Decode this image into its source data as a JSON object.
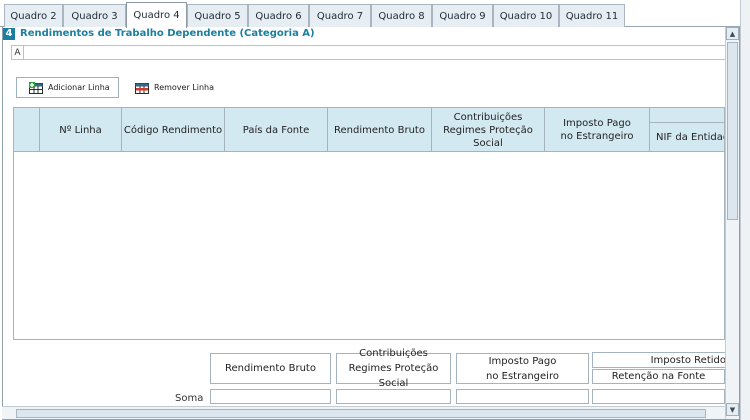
{
  "tabs": [
    {
      "label": "Quadro 2",
      "active": false
    },
    {
      "label": "Quadro 3",
      "active": false
    },
    {
      "label": "Quadro 4",
      "active": true
    },
    {
      "label": "Quadro 5",
      "active": false
    },
    {
      "label": "Quadro 6",
      "active": false
    },
    {
      "label": "Quadro 7",
      "active": false
    },
    {
      "label": "Quadro 8",
      "active": false
    },
    {
      "label": "Quadro 9",
      "active": false
    },
    {
      "label": "Quadro 10",
      "active": false
    },
    {
      "label": "Quadro 11",
      "active": false
    }
  ],
  "section": {
    "number": "4",
    "title": "Rendimentos de Trabalho Dependente (Categoria A)",
    "field_label": "A"
  },
  "toolbar": {
    "add_label": "Adicionar Linha",
    "remove_label": "Remover Linha",
    "add_icon": "add-row-icon",
    "remove_icon": "remove-row-icon"
  },
  "table": {
    "headers": [
      "",
      "Nº Linha",
      "Código Rendimento",
      "País da Fonte",
      "Rendimento Bruto",
      "Contribuições Regimes Proteção Social",
      "Imposto Pago no Estrangeiro",
      "NIF da Entidade Retentora"
    ],
    "rows": []
  },
  "totals": {
    "rendimento_bruto": "Rendimento Bruto",
    "contribuicoes": "Contribuições Regimes Proteção Social",
    "imposto_pago": "Imposto Pago no Estrangeiro",
    "imposto_retido": "Imposto Retido",
    "retencao_fonte": "Retenção na Fonte",
    "soma_label": "Soma"
  },
  "colors": {
    "accent": "#1a7fa2",
    "header_bg": "#d3e9f1",
    "tab_bg": "#e6eef4"
  }
}
